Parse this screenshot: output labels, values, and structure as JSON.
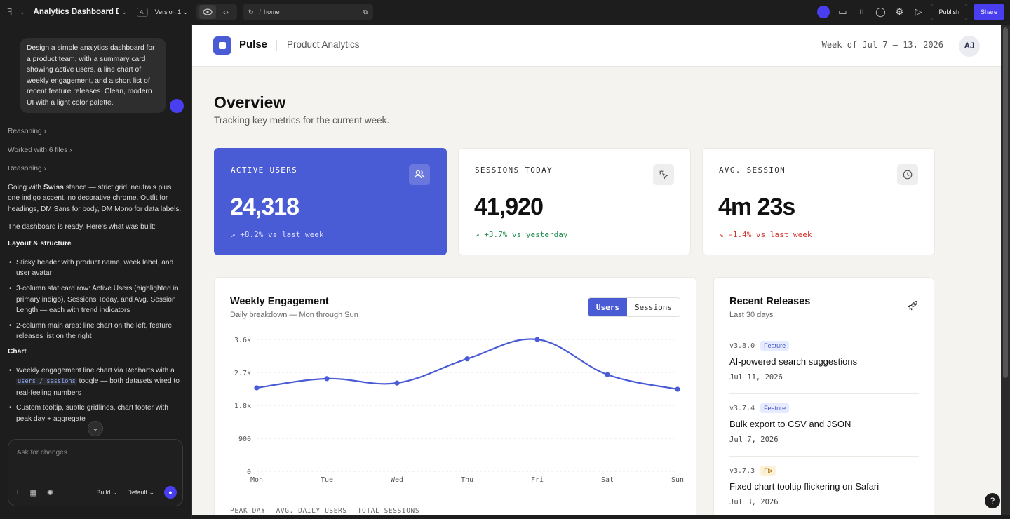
{
  "toolbar": {
    "project_title": "Analytics Dashboard De...",
    "ai_badge": "AI",
    "version": "Version 1",
    "url_slash": "/",
    "url_path": "home",
    "publish_label": "Publish",
    "share_label": "Share"
  },
  "chat": {
    "user_message": "Design a simple analytics dashboard for a product team, with a summary card showing active users, a line chart of weekly engagement, and a short list of recent feature releases. Clean, modern UI with a light color palette.",
    "step1": "Reasoning",
    "step2": "Worked with 6 files",
    "step3": "Reasoning",
    "intro_pre": "Going with ",
    "intro_bold": "Swiss",
    "intro_post": " stance — strict grid, neutrals plus one indigo accent, no decorative chrome. Outfit for headings, DM Sans for body, DM Mono for data labels.",
    "ready": "The dashboard is ready. Here's what was built:",
    "h_layout": "Layout & structure",
    "layout_items": [
      "Sticky header with product name, week label, and user avatar",
      "3-column stat card row: Active Users (highlighted in primary indigo), Sessions Today, and Avg. Session Length — each with trend indicators",
      "2-column main area: line chart on the left, feature releases list on the right"
    ],
    "h_chart": "Chart",
    "chart_item1_pre": "Weekly engagement line chart via Recharts with a ",
    "chart_item1_code": "users / sessions",
    "chart_item1_post": " toggle — both datasets wired to real-feeling numbers",
    "chart_item2": "Custom tooltip, subtle gridlines, chart footer with peak day + aggregate",
    "composer_placeholder": "Ask for changes",
    "mode": "Build",
    "model": "Default"
  },
  "header": {
    "brand": "Pulse",
    "subtitle": "Product Analytics",
    "week": "Week of Jul 7 – 13, 2026",
    "avatar": "AJ"
  },
  "overview": {
    "title": "Overview",
    "subtitle": "Tracking key metrics for the current week."
  },
  "stats": [
    {
      "label": "ACTIVE USERS",
      "value": "24,318",
      "trend": "↗ +8.2% vs last week",
      "icon": "users-icon"
    },
    {
      "label": "SESSIONS TODAY",
      "value": "41,920",
      "trend": "↗ +3.7% vs yesterday",
      "icon": "cursor-click-icon"
    },
    {
      "label": "AVG. SESSION",
      "value": "4m 23s",
      "trend": "↘ -1.4% vs last week",
      "icon": "clock-icon"
    }
  ],
  "engagement": {
    "title": "Weekly Engagement",
    "subtitle": "Daily breakdown — Mon through Sun",
    "toggle_users": "Users",
    "toggle_sessions": "Sessions",
    "footer": [
      "PEAK DAY",
      "AVG. DAILY USERS",
      "TOTAL SESSIONS"
    ]
  },
  "chart_data": {
    "type": "line",
    "categories": [
      "Mon",
      "Tue",
      "Wed",
      "Thu",
      "Fri",
      "Sat",
      "Sun"
    ],
    "values": [
      2280,
      2530,
      2410,
      3070,
      3600,
      2640,
      2240
    ],
    "yticks": [
      "0",
      "900",
      "1.8k",
      "2.7k",
      "3.6k"
    ],
    "ylim": [
      0,
      3600
    ],
    "grid": true,
    "color": "#4a5bd6"
  },
  "releases": {
    "title": "Recent Releases",
    "subtitle": "Last 30 days",
    "items": [
      {
        "version": "v3.8.0",
        "tag": "Feature",
        "name": "AI-powered search suggestions",
        "date": "Jul 11, 2026"
      },
      {
        "version": "v3.7.4",
        "tag": "Feature",
        "name": "Bulk export to CSV and JSON",
        "date": "Jul 7, 2026"
      },
      {
        "version": "v3.7.3",
        "tag": "Fix",
        "name": "Fixed chart tooltip flickering on Safari",
        "date": "Jul 3, 2026"
      }
    ]
  }
}
